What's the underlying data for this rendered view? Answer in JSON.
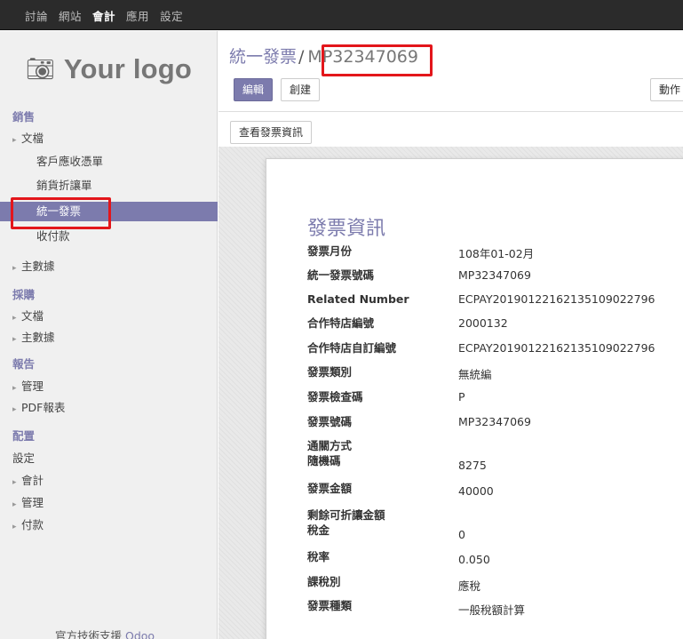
{
  "topnav": {
    "items": [
      {
        "label": "討論",
        "active": false
      },
      {
        "label": "網站",
        "active": false
      },
      {
        "label": "會計",
        "active": true
      },
      {
        "label": "應用",
        "active": false
      },
      {
        "label": "設定",
        "active": false
      }
    ]
  },
  "logo": {
    "text": "Your logo",
    "icon": "camera-icon"
  },
  "sidebar": {
    "sales_header": "銷售",
    "sales_docs": "文檔",
    "customer_invoices": "客戶應收憑單",
    "sales_credit": "銷貨折讓單",
    "uniform_invoice": "統一發票",
    "payments": "收付款",
    "sales_master": "主數據",
    "purchase_header": "採購",
    "purchase_docs": "文檔",
    "purchase_master": "主數據",
    "report_header": "報告",
    "report_manage": "管理",
    "report_pdf": "PDF報表",
    "config_header": "配置",
    "config_settings": "設定",
    "config_accounting": "會計",
    "config_manage": "管理",
    "config_payment": "付款",
    "support_text": "官方技術支援",
    "support_link": "Odoo"
  },
  "header": {
    "breadcrumb_parent": "統一發票",
    "breadcrumb_sep": "/",
    "breadcrumb_current": "MP32347069",
    "edit_label": "編輯",
    "create_label": "創建",
    "action_label": "動作",
    "view_info_label": "查看發票資訊"
  },
  "sheet": {
    "title": "發票資訊",
    "fields": [
      {
        "label": "發票月份",
        "value": "108年01-02月"
      },
      {
        "label": "統一發票號碼",
        "value": "MP32347069"
      },
      {
        "label": "Related Number",
        "value": "ECPAY20190122162135109022796"
      },
      {
        "label": "合作特店編號",
        "value": "2000132"
      },
      {
        "label": "合作特店自訂編號",
        "value": "ECPAY20190122162135109022796"
      },
      {
        "label": "發票類別",
        "value": "無統編"
      },
      {
        "label": "發票檢查碼",
        "value": "P"
      },
      {
        "label": "發票號碼",
        "value": "MP32347069"
      },
      {
        "label": "通關方式",
        "value": ""
      },
      {
        "label": "隨機碼",
        "value": "8275"
      },
      {
        "label": "發票金額",
        "value": "40000"
      },
      {
        "label": "剩餘可折讓金額",
        "value": ""
      },
      {
        "label": "稅金",
        "value": "0"
      },
      {
        "label": "稅率",
        "value": "0.050"
      },
      {
        "label": "課稅別",
        "value": "應稅"
      },
      {
        "label": "發票種類",
        "value": "一般稅額計算"
      }
    ]
  },
  "colors": {
    "accent": "#7c7bad",
    "highlight": "#e3161b",
    "topbar": "#2b2b2b"
  }
}
